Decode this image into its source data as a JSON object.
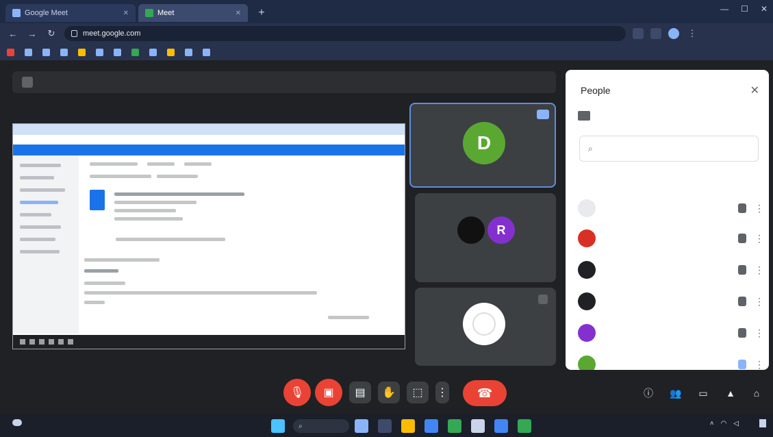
{
  "browser": {
    "tabs": [
      {
        "label": "Google Meet",
        "active": false
      },
      {
        "label": "Meet",
        "active": true
      },
      {
        "label": "",
        "active": false
      }
    ],
    "new_tab_icon": "plus-icon",
    "url": "meet.google.com",
    "bookmarks": [
      "",
      "",
      "",
      "",
      "",
      "",
      "",
      "",
      "",
      "",
      "",
      ""
    ]
  },
  "meet": {
    "presenting_banner": "",
    "tiles": [
      {
        "initial": "D",
        "name": "",
        "color": "#5aa832"
      },
      {
        "initial": "R",
        "name": "",
        "color": "#8430ce"
      },
      {
        "initial": "",
        "name": "",
        "color": "#ffffff"
      }
    ],
    "meeting_info": "",
    "leave_icon": "call-end-icon"
  },
  "people": {
    "title": "People",
    "add_label": "",
    "search_placeholder": "",
    "section_label": "",
    "participants": [
      {
        "name": "",
        "color": "#9aa0a6"
      },
      {
        "name": "",
        "color": "#d93025"
      },
      {
        "name": "",
        "color": "#202124"
      },
      {
        "name": "",
        "color": "#202124"
      },
      {
        "name": "",
        "color": "#8430ce"
      },
      {
        "name": "",
        "color": "#5aa832"
      }
    ]
  },
  "taskbar": {
    "search_label": "",
    "time": "",
    "date": ""
  }
}
